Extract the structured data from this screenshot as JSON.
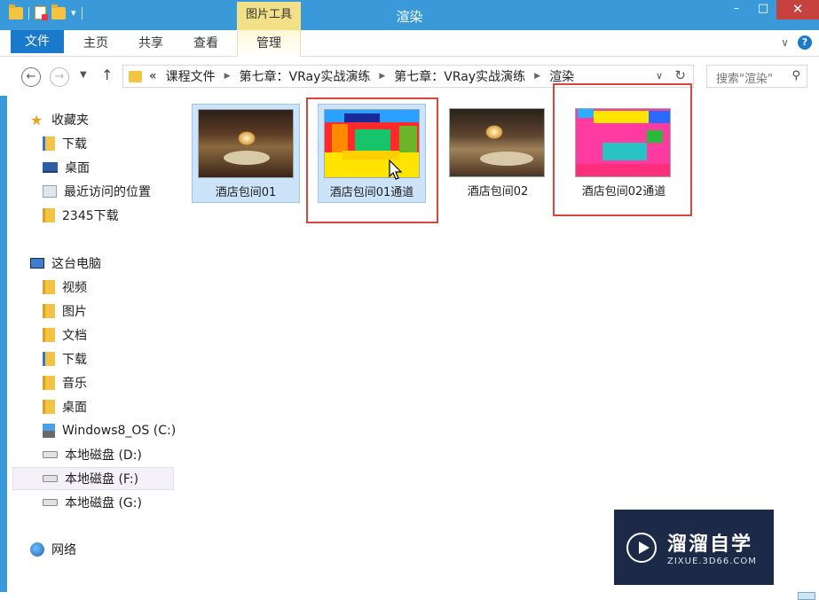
{
  "titlebar": {
    "title": "渲染",
    "contextual_tab": "图片工具",
    "controls": {
      "minimize": "–",
      "maximize": "□",
      "close": "✕"
    }
  },
  "ribbon": {
    "tabs": [
      "文件",
      "主页",
      "共享",
      "查看",
      "管理"
    ],
    "help": "?"
  },
  "address": {
    "overflow": "«",
    "crumbs": [
      "课程文件",
      "第七章：VRay实战演练",
      "第七章：VRay实战演练",
      "渲染"
    ],
    "search_placeholder": "搜索\"渲染\""
  },
  "nav": {
    "favorites": {
      "label": "收藏夹",
      "items": [
        "下载",
        "桌面",
        "最近访问的位置",
        "2345下载"
      ]
    },
    "this_pc": {
      "label": "这台电脑",
      "items": [
        "视频",
        "图片",
        "文档",
        "下载",
        "音乐",
        "桌面",
        "Windows8_OS (C:)",
        "本地磁盘 (D:)",
        "本地磁盘 (F:)",
        "本地磁盘 (G:)"
      ]
    },
    "network": {
      "label": "网络"
    }
  },
  "files": [
    {
      "name": "酒店包间01",
      "kind": "render",
      "selected": true
    },
    {
      "name": "酒店包间01通道",
      "kind": "channel",
      "selected": true,
      "highlighted": true
    },
    {
      "name": "酒店包间02",
      "kind": "render",
      "selected": false
    },
    {
      "name": "酒店包间02通道",
      "kind": "channel",
      "selected": false,
      "highlighted": true
    }
  ],
  "watermark": {
    "title": "溜溜自学",
    "subtitle": "ZIXUE.3D66.COM"
  },
  "colors": {
    "titlebar": "#3a9ad9",
    "file_tab": "#1979ca",
    "contextual_tab": "#f3e18a",
    "selection": "#cce3f9",
    "highlight_box": "#d8453f"
  }
}
